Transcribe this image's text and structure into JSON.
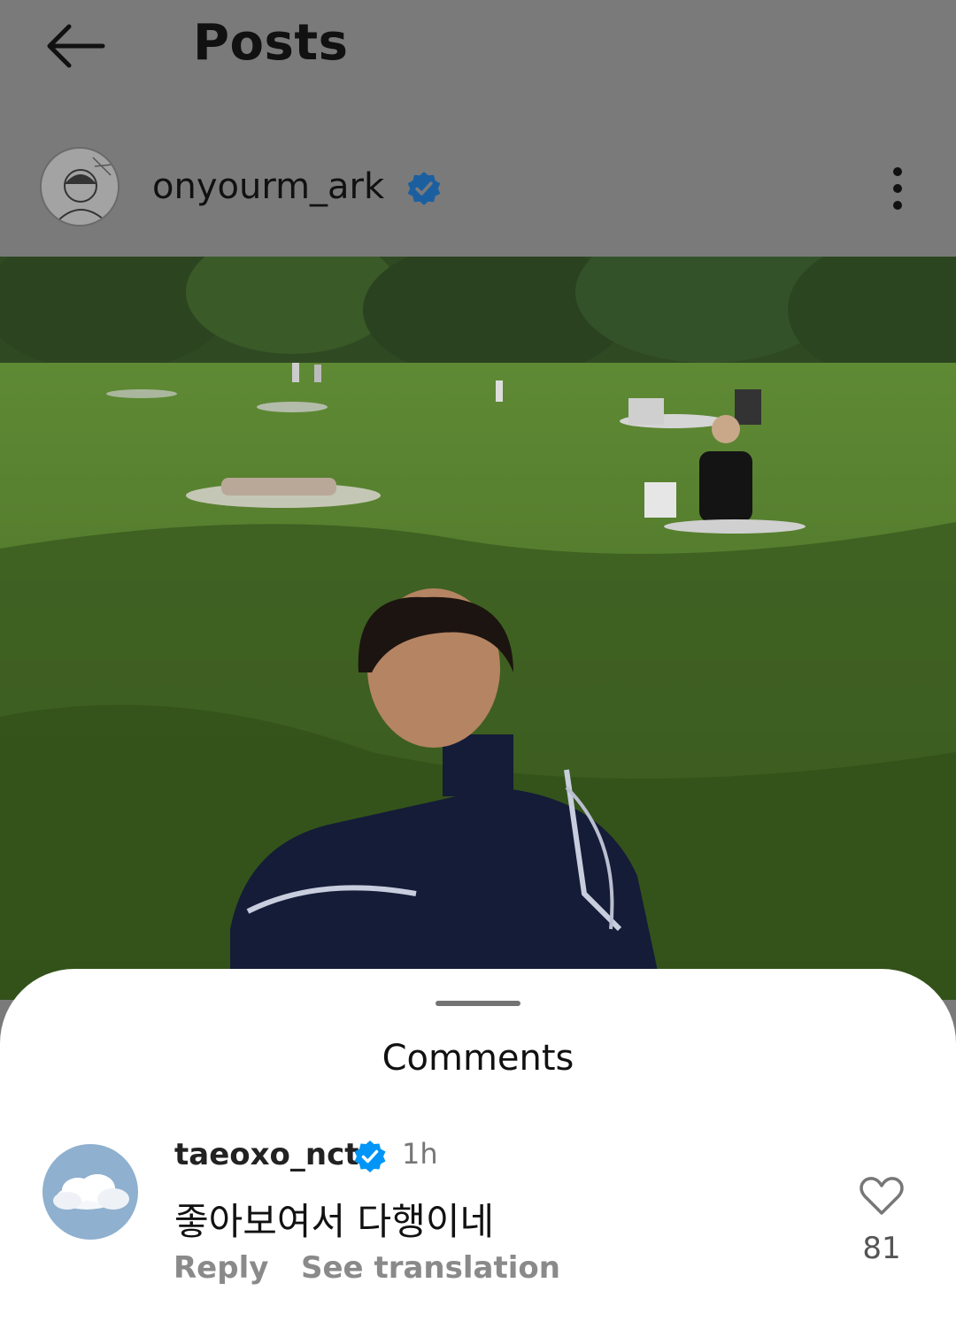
{
  "header": {
    "title": "Posts",
    "back_icon": "arrow-left-icon"
  },
  "post": {
    "username": "onyourm_ark",
    "verified": true,
    "more_icon": "vertical-dots-icon"
  },
  "comments_sheet": {
    "title": "Comments",
    "comment": {
      "username": "taeoxo_nct",
      "verified": true,
      "time": "1h",
      "text": "좋아보여서 다행이네",
      "reply_label": "Reply",
      "translate_label": "See translation",
      "likes": "81",
      "like_icon": "heart-outline-icon"
    }
  },
  "colors": {
    "verified_blue": "#0095f6",
    "overlay_gray": "#7a7a7a"
  }
}
